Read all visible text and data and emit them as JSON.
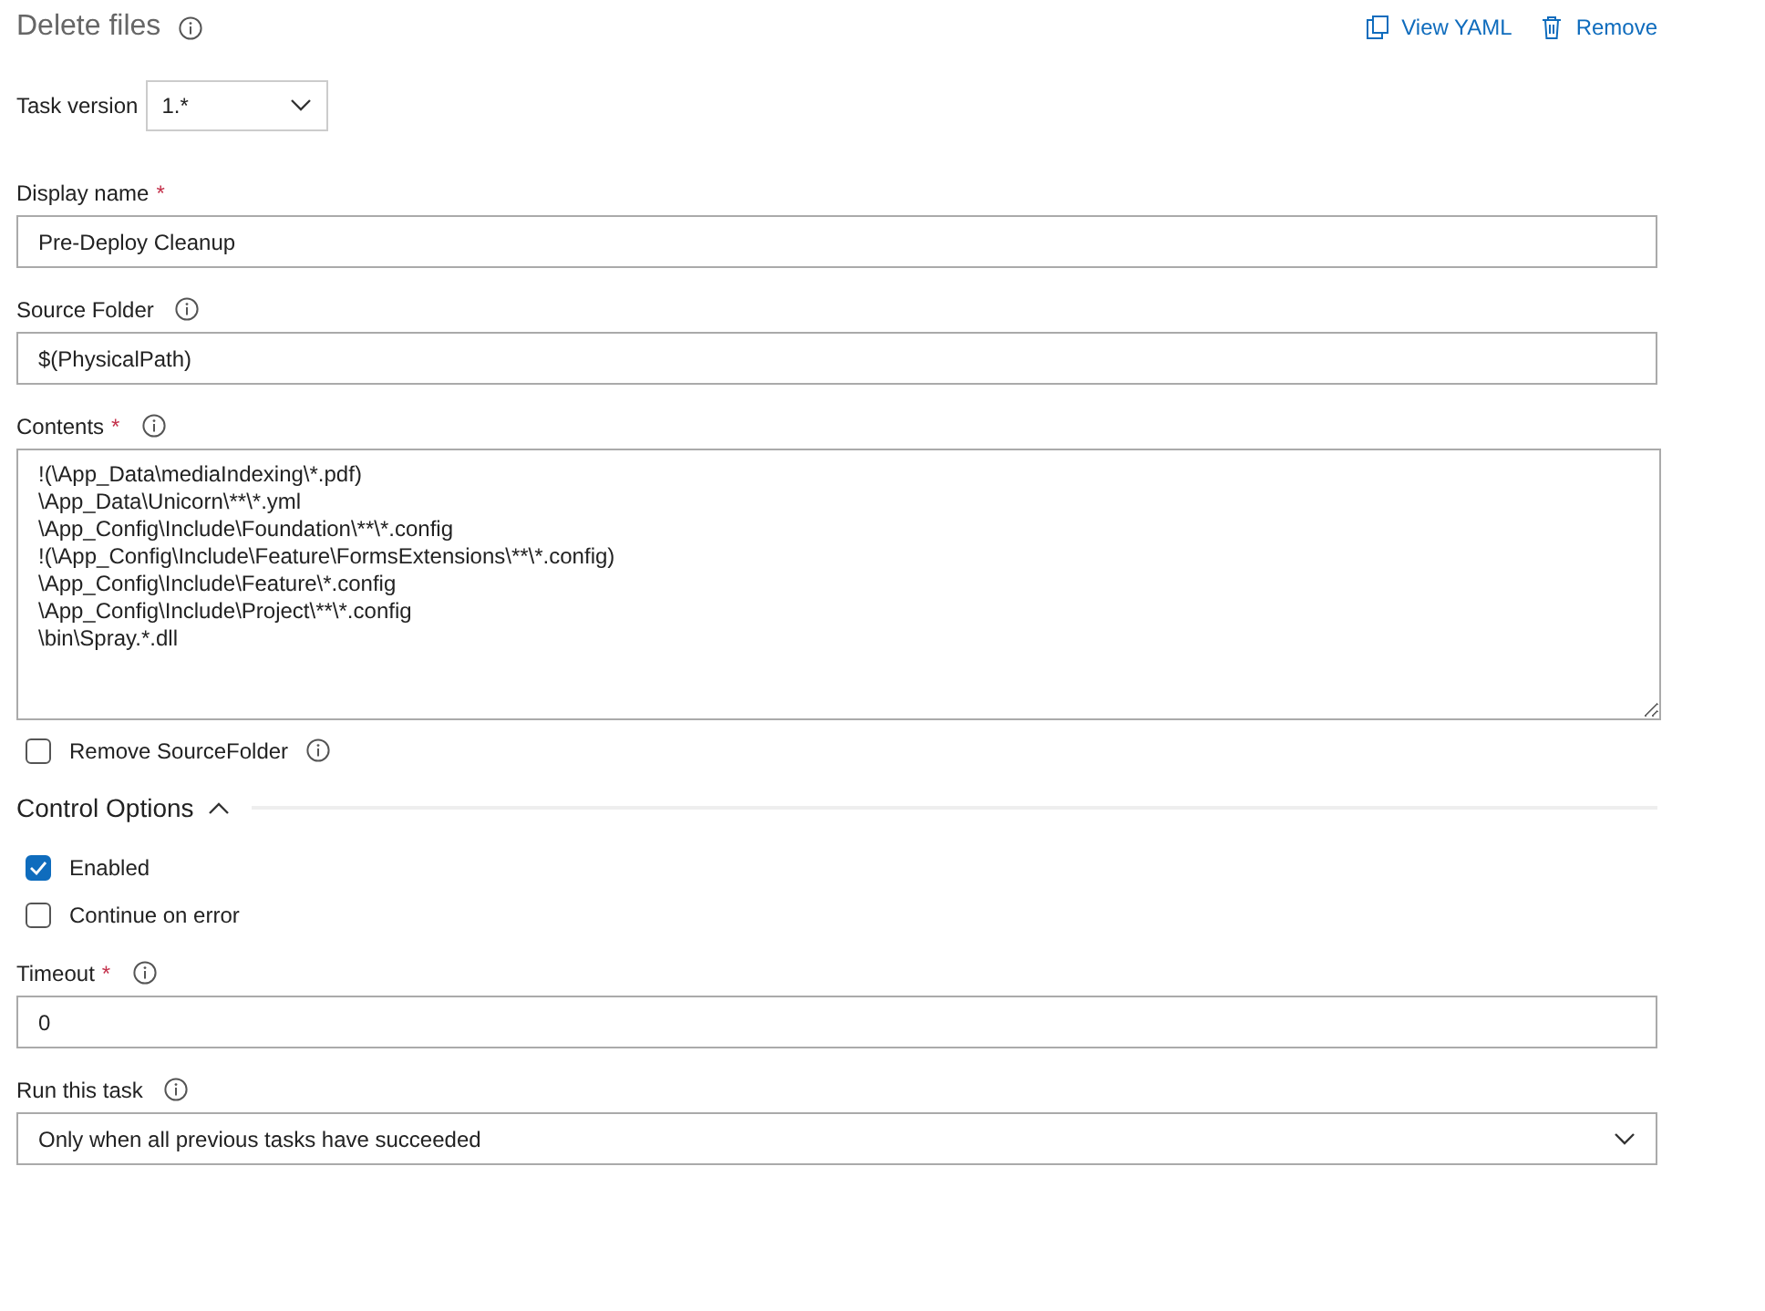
{
  "header": {
    "title": "Delete files",
    "info": true,
    "actions": [
      {
        "kind": "yaml",
        "label": "View YAML"
      },
      {
        "kind": "remove",
        "label": "Remove"
      }
    ]
  },
  "task_version": {
    "label": "Task version",
    "value": "1.*"
  },
  "items": [
    {
      "kind": "text",
      "label": "Display name",
      "marker": "*",
      "info": false,
      "value": "Pre-Deploy Cleanup"
    },
    {
      "kind": "text",
      "label": "Source Folder",
      "info": true,
      "value": "$(PhysicalPath)"
    },
    {
      "kind": "textarea",
      "label": "Contents",
      "marker": "*",
      "info": true,
      "lines": [
        "!(\\App_Data\\mediaIndexing\\*.pdf)",
        "\\App_Data\\Unicorn\\**\\*.yml",
        "\\App_Config\\Include\\Foundation\\**\\*.config",
        "!(\\App_Config\\Include\\Feature\\FormsExtensions\\**\\*.config)",
        "\\App_Config\\Include\\Feature\\*.config",
        "\\App_Config\\Include\\Project\\**\\*.config",
        "\\bin\\Spray.*.dll"
      ]
    },
    {
      "kind": "checkbox",
      "label": "Remove SourceFolder",
      "info": true,
      "checked": false
    },
    {
      "kind": "section",
      "label": "Control Options",
      "expanded": true
    },
    {
      "kind": "checkbox",
      "label": "Enabled",
      "info": false,
      "checked": true
    },
    {
      "kind": "checkbox",
      "label": "Continue on error",
      "info": false,
      "checked": false
    },
    {
      "kind": "text",
      "label": "Timeout",
      "marker": "*",
      "info": true,
      "value": "0"
    },
    {
      "kind": "select",
      "label": "Run this task",
      "info": true,
      "value": "Only when all previous tasks have succeeded"
    }
  ]
}
